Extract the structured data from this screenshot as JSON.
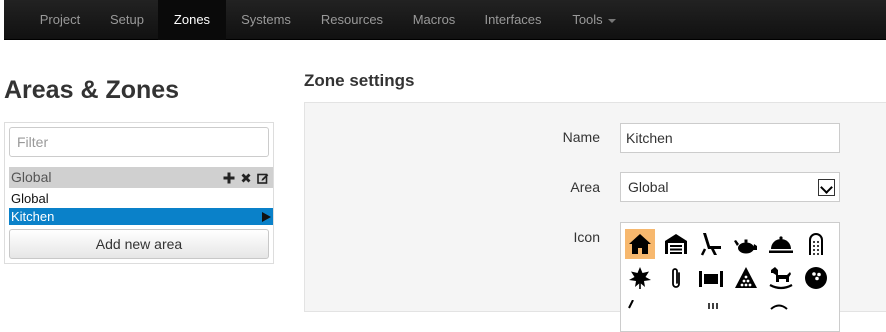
{
  "navbar": {
    "items": [
      {
        "label": "Project",
        "active": false
      },
      {
        "label": "Setup",
        "active": false
      },
      {
        "label": "Zones",
        "active": true
      },
      {
        "label": "Systems",
        "active": false
      },
      {
        "label": "Resources",
        "active": false
      },
      {
        "label": "Macros",
        "active": false
      },
      {
        "label": "Interfaces",
        "active": false
      },
      {
        "label": "Tools",
        "active": false,
        "dropdown": true
      }
    ]
  },
  "left": {
    "title": "Areas & Zones",
    "filter_placeholder": "Filter",
    "group": {
      "label": "Global",
      "actions": [
        "plus-icon",
        "close-icon",
        "edit-icon"
      ]
    },
    "zones": [
      {
        "label": "Global",
        "selected": false
      },
      {
        "label": "Kitchen",
        "selected": true
      }
    ],
    "add_button": "Add new area"
  },
  "settings": {
    "title": "Zone settings",
    "name_label": "Name",
    "name_value": "Kitchen",
    "area_label": "Area",
    "area_value": "Global",
    "icon_label": "Icon",
    "icons": [
      "house-icon",
      "garage-icon",
      "lounge-chair-icon",
      "teapot-icon",
      "serving-dish-icon",
      "shower-icon",
      "maple-leaf-icon",
      "paperclip-icon",
      "bed-icon",
      "billiards-icon",
      "rocking-horse-icon",
      "bowling-ball-icon"
    ],
    "selected_icon": "house-icon",
    "accent_color": "#0a81c9",
    "selected_icon_bg": "#f7b86e"
  }
}
